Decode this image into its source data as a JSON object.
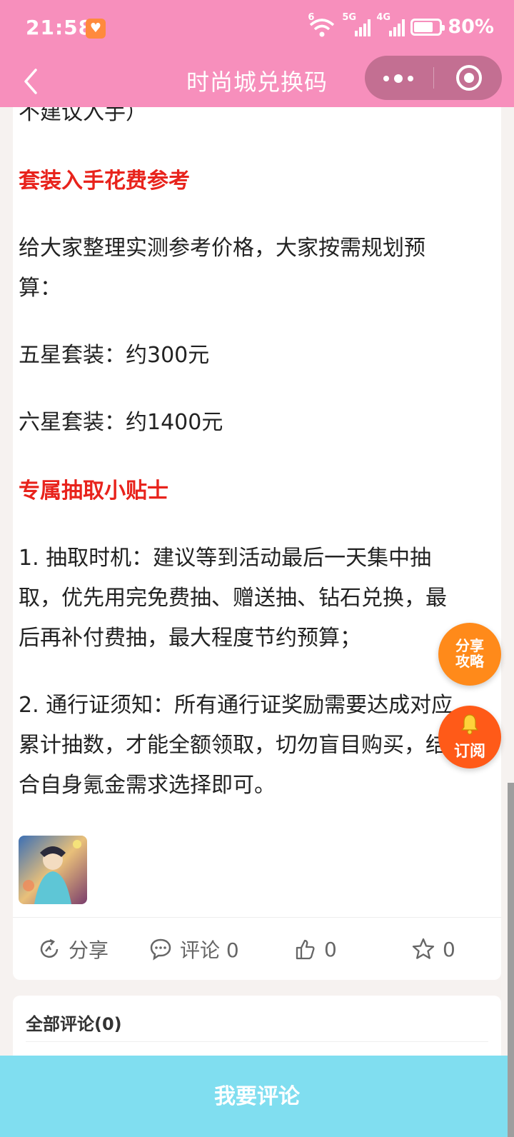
{
  "status_bar": {
    "time": "21:58",
    "network_5g": "5G",
    "network_4g": "4G",
    "wifi_badge": "6",
    "battery": "80%"
  },
  "nav": {
    "title": "时尚城兑换码"
  },
  "article": {
    "fragment": "不建议入手）",
    "heading_cost": "套装入手花费参考",
    "intro_line1": "给大家整理实测参考价格，大家按需规划预",
    "intro_line2": "算：",
    "five_star": "五星套装：约300元",
    "six_star": "六星套装：约1400元",
    "heading_tips": "专属抽取小贴士",
    "tip1_line1": "1. 抽取时机：建议等到活动最后一天集中抽",
    "tip1_line2": "取，优先用完免费抽、赠送抽、钻石兑换，最",
    "tip1_line3": "后再补付费抽，最大程度节约预算；",
    "tip2_line1": "2. 通行证须知：所有通行证奖励需要达成对应",
    "tip2_line2": "累计抽数，才能全额领取，切勿盲目购买，结",
    "tip2_line3": "合自身氪金需求选择即可。"
  },
  "actions": {
    "share": "分享",
    "comment": "评论 0",
    "like": "0",
    "favorite": "0"
  },
  "comments": {
    "title": "全部评论(0)"
  },
  "bottom": {
    "label": "我要评论"
  },
  "floating": {
    "share_line1": "分享",
    "share_line2": "攻略",
    "subscribe": "订阅"
  },
  "colors": {
    "header": "#f78fbc",
    "heading_red": "#e8231c",
    "bottom_bar": "#80def0",
    "float_orange": "#ff8a1a",
    "float_red_orange": "#ff5a18"
  }
}
